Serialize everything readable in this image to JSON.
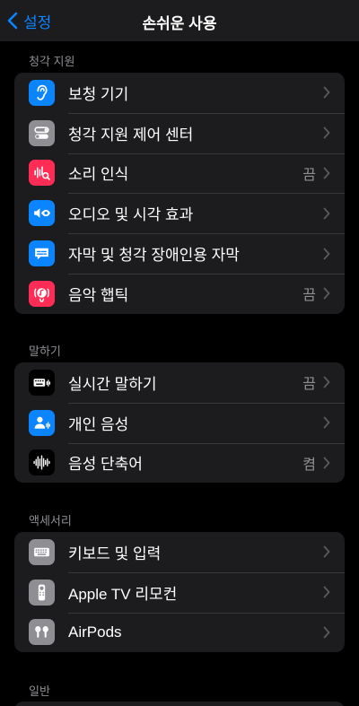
{
  "nav": {
    "back_label": "설정",
    "title": "손쉬운 사용"
  },
  "sections": [
    {
      "header": "청각 지원",
      "rows": [
        {
          "label": "보청 기기",
          "value": ""
        },
        {
          "label": "청각 지원 제어 센터",
          "value": ""
        },
        {
          "label": "소리 인식",
          "value": "끔"
        },
        {
          "label": "오디오 및 시각 효과",
          "value": ""
        },
        {
          "label": "자막 및 청각 장애인용 자막",
          "value": ""
        },
        {
          "label": "음악 햅틱",
          "value": "끔"
        }
      ]
    },
    {
      "header": "말하기",
      "rows": [
        {
          "label": "실시간 말하기",
          "value": "끔"
        },
        {
          "label": "개인 음성",
          "value": ""
        },
        {
          "label": "음성 단축어",
          "value": "켬"
        }
      ]
    },
    {
      "header": "액세서리",
      "rows": [
        {
          "label": "키보드 및 입력",
          "value": ""
        },
        {
          "label": "Apple TV 리모컨",
          "value": ""
        },
        {
          "label": "AirPods",
          "value": ""
        }
      ]
    },
    {
      "header": "일반",
      "rows": []
    }
  ],
  "colors": {
    "accent": "#0a84ff",
    "hearing_devices": "#0a84ff",
    "control_center": "#8e8e93",
    "sound_recognition": "#ff2d55",
    "audio_visual": "#0a84ff",
    "subtitles": "#0a84ff",
    "music_haptics": "#ff2d55",
    "live_speech": "#000000",
    "personal_voice": "#0a84ff",
    "vocal_shortcuts": "#000000",
    "keyboards": "#8e8e93",
    "apple_tv_remote": "#8e8e93",
    "airpods": "#8e8e93"
  },
  "icons": [
    "ear-icon",
    "toggles-icon",
    "waveform-search-icon",
    "speaker-eye-icon",
    "caption-bubble-icon",
    "music-haptics-icon",
    "keyboard-wave-icon",
    "person-wave-icon",
    "waveform-icon",
    "keyboard-icon",
    "remote-icon",
    "airpods-icon"
  ]
}
